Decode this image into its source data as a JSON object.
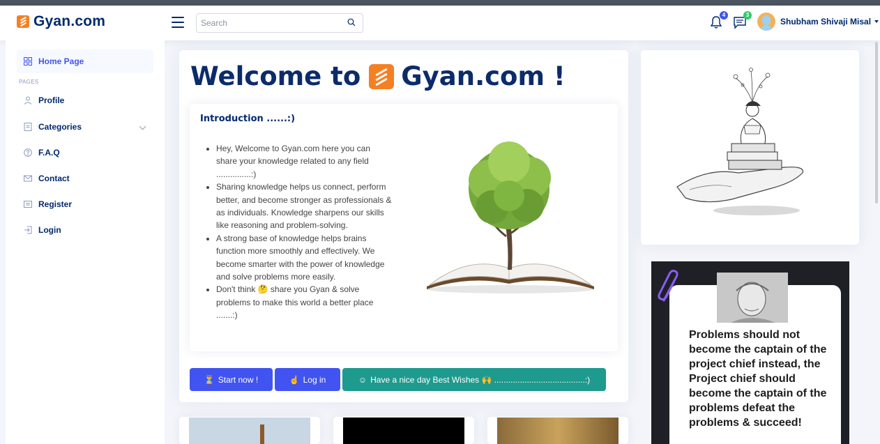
{
  "brand": {
    "name": "Gyan.com",
    "logo_color": "#f48024",
    "text_color": "#012970"
  },
  "header": {
    "search_placeholder": "Search",
    "notifications_count": "4",
    "messages_count": "3",
    "user_name": "Shubham Shivaji Misal"
  },
  "sidebar": {
    "section_heading": "PAGES",
    "items": [
      {
        "label": "Home Page",
        "icon": "grid-icon",
        "active": true
      },
      {
        "label": "Profile",
        "icon": "person-icon"
      },
      {
        "label": "Categories",
        "icon": "card-list-icon"
      },
      {
        "label": "F.A.Q",
        "icon": "question-circle-icon"
      },
      {
        "label": "Contact",
        "icon": "envelope-icon"
      },
      {
        "label": "Register",
        "icon": "card-icon"
      },
      {
        "label": "Login",
        "icon": "box-arrow-in-icon"
      }
    ]
  },
  "main": {
    "welcome_prefix": "Welcome to",
    "welcome_suffix": "Gyan.com !",
    "intro_title": "Introduction ......:)",
    "bullets": [
      "Hey, Welcome to Gyan.com here you can share your knowledge related to any field ...............:)",
      "Sharing knowledge helps us connect, perform better, and become stronger as professionals & as individuals. Knowledge sharpens our skills like reasoning and problem-solving.",
      "A strong base of knowledge helps brains function more smoothly and effectively. We become smarter with the power of knowledge and solve problems more easily.",
      "Don't think 🤔 share you Gyan & solve problems to make this world a better place .......:)"
    ],
    "buttons": {
      "start": "Start now !",
      "login": "Log in",
      "wishes": "Have a nice day Best Wishes 🙌 .......................................:)"
    }
  },
  "quote": {
    "text": "Problems should not become the captain of the project chief instead, the Project chief should become the captain of the problems defeat the problems & succeed!"
  },
  "colors": {
    "primary": "#4154f1",
    "teal": "#1e9a8e",
    "navy": "#012970"
  }
}
